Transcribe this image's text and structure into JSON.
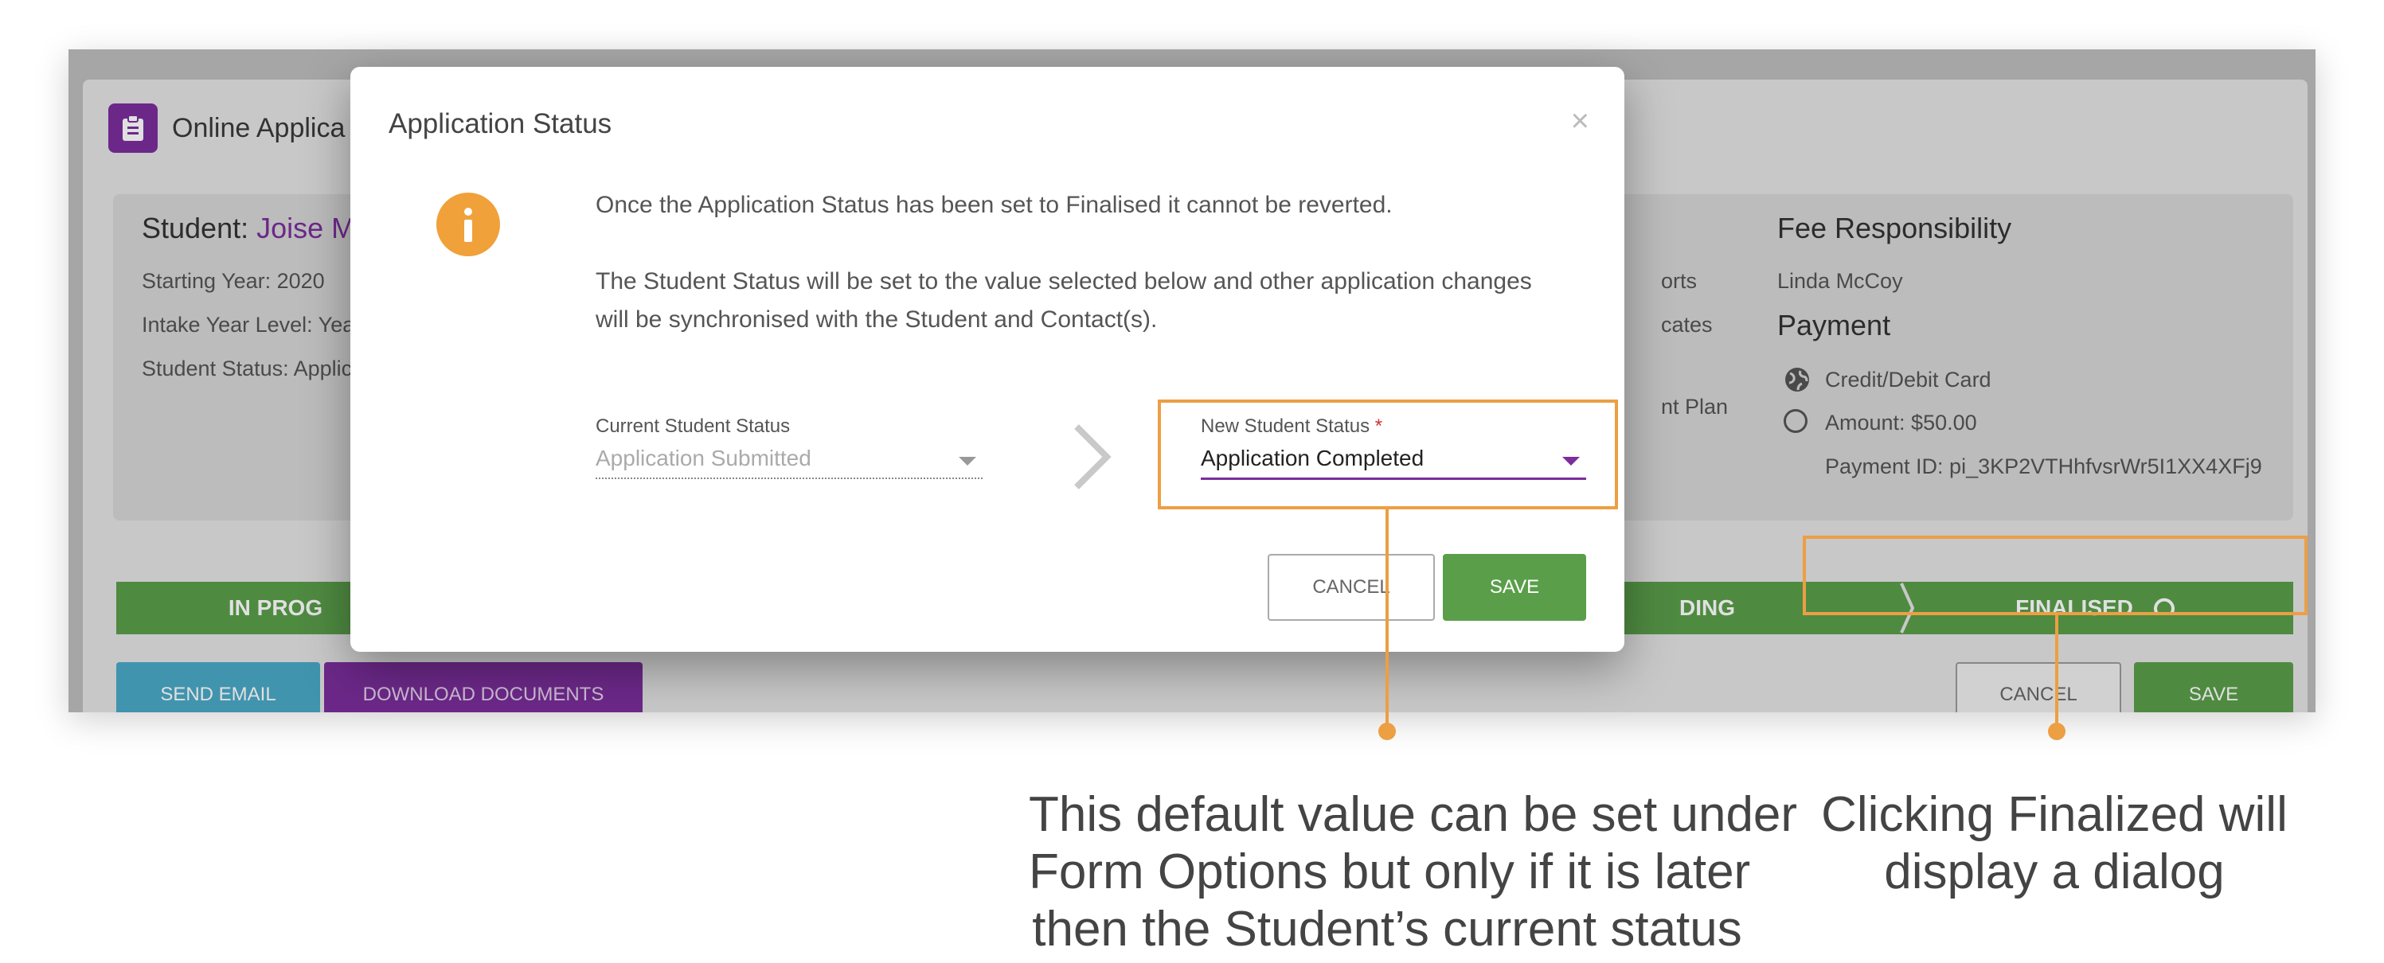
{
  "app": {
    "title": "Online Applica",
    "icon": "clipboard-icon"
  },
  "student": {
    "label": "Student:",
    "name": "Joise M",
    "starting_year": "Starting Year: 2020",
    "intake_year": "Intake Year Level: Yea",
    "status": "Student Status: Applic"
  },
  "middle_fragments": {
    "reports": "orts",
    "certificates": "cates",
    "payment_plan": "nt Plan"
  },
  "fees": {
    "heading": "Fee Responsibility",
    "responsible": "Linda McCoy",
    "payment_heading": "Payment",
    "method": "Credit/Debit Card",
    "amount": "Amount: $50.00",
    "payment_id": "Payment ID: pi_3KP2VTHhfvsrWr5I1XX4XFj9"
  },
  "progress": {
    "in_progress": "IN PROG",
    "pending": "DING",
    "finalised": "FINALISED"
  },
  "actions": {
    "send_email": "SEND EMAIL",
    "download_documents": "DOWNLOAD DOCUMENTS",
    "cancel": "CANCEL",
    "save": "SAVE"
  },
  "modal": {
    "title": "Application Status",
    "close": "×",
    "message1": "Once the Application Status has been set to Finalised it cannot be reverted.",
    "message2_line1": "The Student Status will be set to the value selected below and other application changes",
    "message2_line2": "will be synchronised with the Student and Contact(s).",
    "current_status_label": "Current Student Status",
    "current_status_value": "Application Submitted",
    "new_status_label": "New Student Status",
    "required_mark": "*",
    "new_status_value": "Application Completed",
    "cancel": "CANCEL",
    "save": "SAVE"
  },
  "callouts": {
    "default_line1": "This default value can be set under",
    "default_line2": "Form Options but only if it is later",
    "default_line3": "then the Student’s current status",
    "finalize_line1": "Clicking Finalized will",
    "finalize_line2": "display a dialog"
  },
  "colors": {
    "accent_purple": "#7b2e9c",
    "green": "#5a9e4a",
    "teal": "#4ba9c6",
    "orange": "#ec9f43",
    "info_orange": "#f0a13a"
  }
}
